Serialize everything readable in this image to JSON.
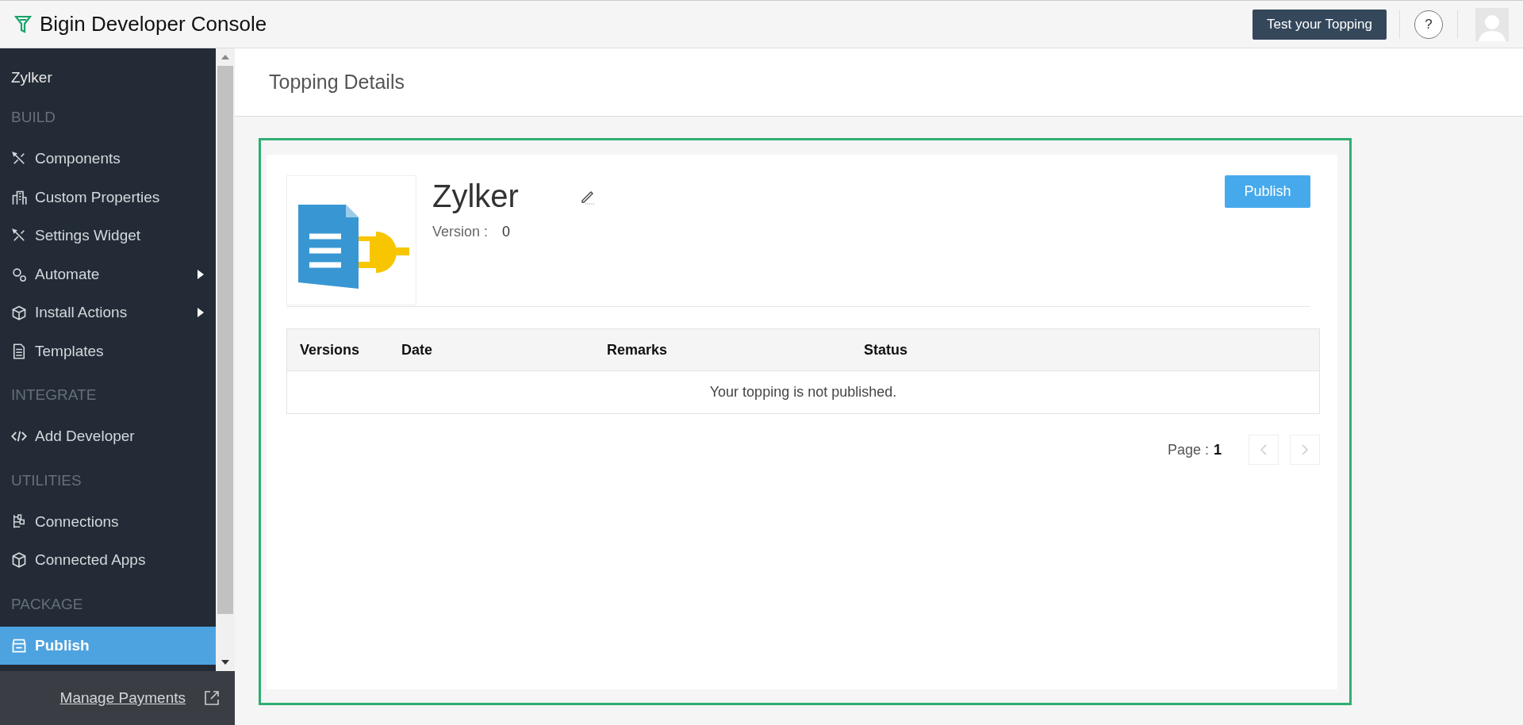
{
  "header": {
    "title": "Bigin Developer Console",
    "test_button": "Test your Topping",
    "help_button": "?"
  },
  "sidebar": {
    "org": "Zylker",
    "sections": [
      {
        "heading": "BUILD",
        "items": [
          {
            "label": "Components",
            "submenu": false,
            "selected": false
          },
          {
            "label": "Custom Properties",
            "submenu": false,
            "selected": false
          },
          {
            "label": "Settings Widget",
            "submenu": false,
            "selected": false
          },
          {
            "label": "Automate",
            "submenu": true,
            "selected": false
          },
          {
            "label": "Install Actions",
            "submenu": true,
            "selected": false
          },
          {
            "label": "Templates",
            "submenu": false,
            "selected": false
          }
        ]
      },
      {
        "heading": "INTEGRATE",
        "items": [
          {
            "label": "Add Developer",
            "submenu": false,
            "selected": false
          }
        ]
      },
      {
        "heading": "UTILITIES",
        "items": [
          {
            "label": "Connections",
            "submenu": false,
            "selected": false
          },
          {
            "label": "Connected Apps",
            "submenu": false,
            "selected": false
          }
        ]
      },
      {
        "heading": "PACKAGE",
        "items": [
          {
            "label": "Publish",
            "submenu": false,
            "selected": true
          }
        ]
      }
    ],
    "footer_link": "Manage Payments"
  },
  "page_title": "Topping Details",
  "topping": {
    "name": "Zylker",
    "version_label": "Version :",
    "version": "0",
    "publish_button": "Publish"
  },
  "table": {
    "columns": [
      "Versions",
      "Date",
      "Remarks",
      "Status"
    ],
    "empty_message": "Your topping is not published."
  },
  "pagination": {
    "label": "Page :",
    "page": "1"
  }
}
